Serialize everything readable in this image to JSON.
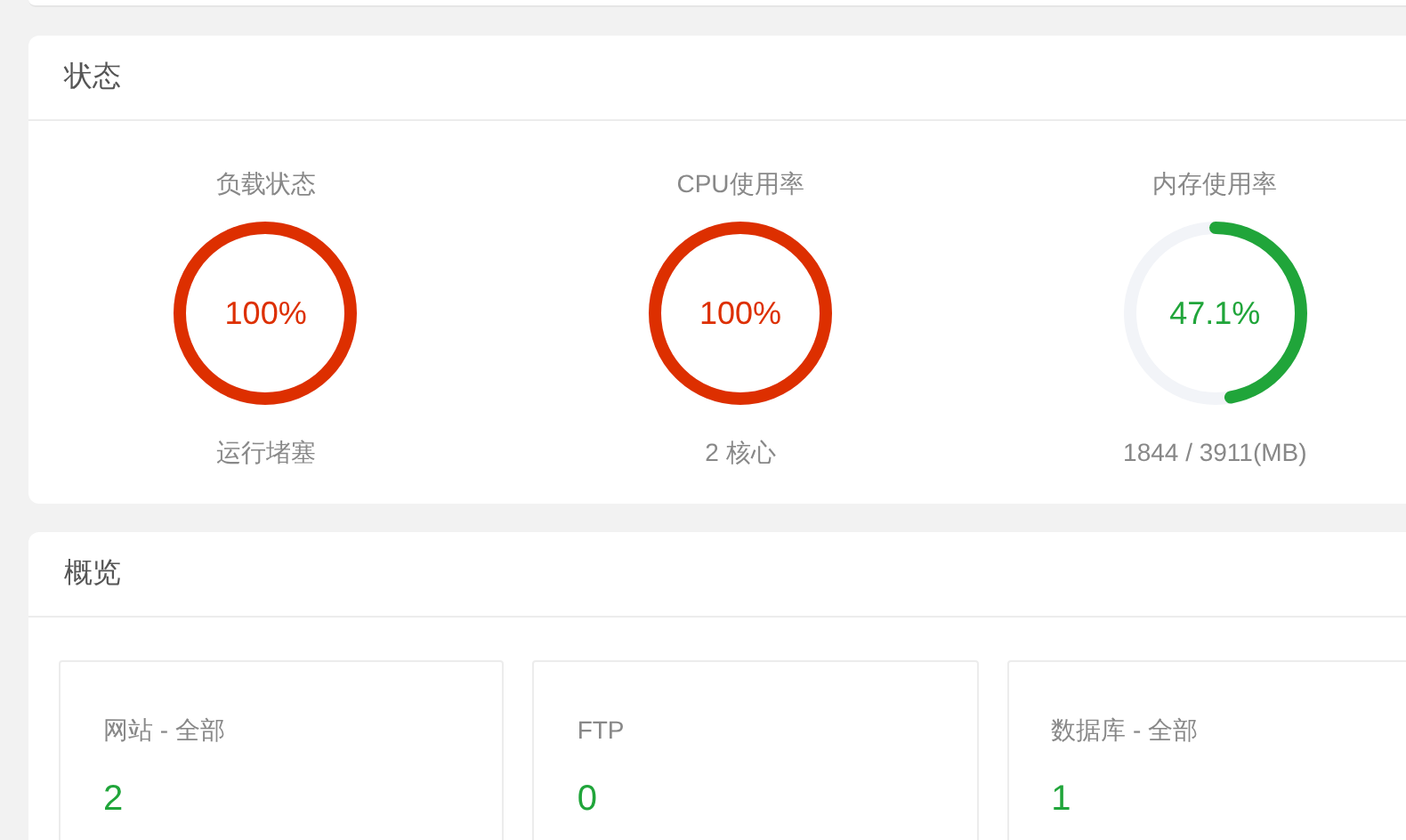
{
  "status_panel": {
    "title": "状态",
    "gauges": [
      {
        "label": "负载状态",
        "reading": "100%",
        "level": 1,
        "color": "#dd2f00",
        "caption": "运行堵塞"
      },
      {
        "label": "CPU使用率",
        "reading": "100%",
        "level": 1,
        "color": "#dd2f00",
        "caption": "2 核心"
      },
      {
        "label": "内存使用率",
        "reading": "47.1%",
        "level": 0.471,
        "color": "#20a53a",
        "caption": "1844 / 3911(MB)"
      }
    ]
  },
  "overview_panel": {
    "title": "概览",
    "cards": [
      {
        "label": "网站 - 全部",
        "value": "2"
      },
      {
        "label": "FTP",
        "value": "0"
      },
      {
        "label": "数据库 - 全部",
        "value": "1"
      }
    ]
  }
}
